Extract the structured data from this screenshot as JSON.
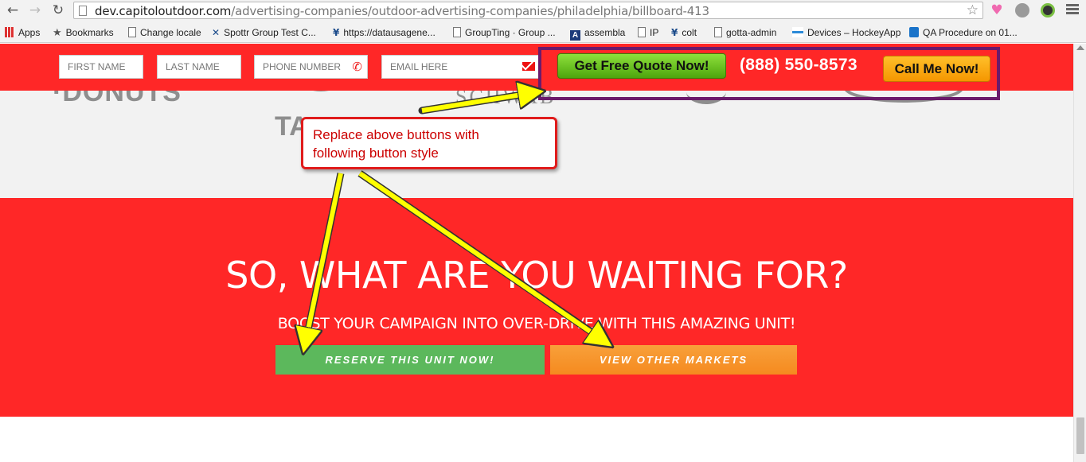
{
  "browser": {
    "url_host": "dev.capitoloutdoor.com",
    "url_path": "/advertising-companies/outdoor-advertising-companies/philadelphia/billboard-413",
    "bookmarks": [
      "Apps",
      "Bookmarks",
      "Change locale",
      "Spottr Group Test C...",
      "https://datausagene...",
      "GroupTing · Group ...",
      "assembla",
      "IP",
      "colt",
      "gotta-admin",
      "Devices – HockeyApp",
      "QA Procedure on 01..."
    ]
  },
  "header_form": {
    "first_name_placeholder": "FIRST NAME",
    "last_name_placeholder": "LAST NAME",
    "phone_placeholder": "PHONE NUMBER",
    "email_placeholder": "EMAIL HERE",
    "quote_button": "Get Free Quote Now!",
    "phone_number": "(888) 550-8573",
    "call_button": "Call Me Now!"
  },
  "logos": {
    "schwab": "SCHWAB",
    "ta": "TA"
  },
  "cta": {
    "heading": "SO, WHAT ARE YOU WAITING FOR?",
    "subheading": "BOOST YOUR CAMPAIGN INTO OVER-DRIVE WITH THIS AMAZING UNIT!",
    "reserve_button": "RESERVE THIS UNIT NOW!",
    "markets_button": "VIEW OTHER MARKETS"
  },
  "annotation": {
    "note_line1": "Replace above buttons with",
    "note_line2": "following button style"
  },
  "colors": {
    "brand_red": "#ff2727",
    "green_button": "#5cb85c",
    "orange_button": "#f58a1f",
    "annotation_red": "#e01c1c",
    "annotation_yellow": "#ffff00",
    "highlight_purple": "#6b1a6b"
  }
}
